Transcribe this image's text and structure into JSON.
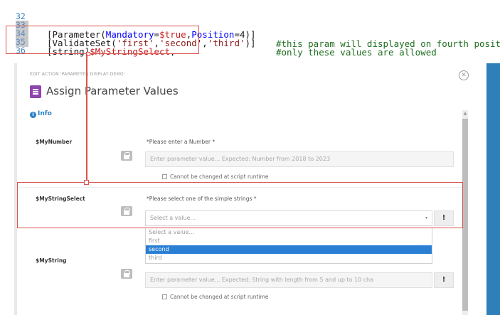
{
  "code": {
    "lines": [
      {
        "num": "32",
        "content": [],
        "comment": ""
      },
      {
        "num": "33",
        "content": [
          {
            "t": "[Parameter(",
            "c": ""
          },
          {
            "t": "Mandatory",
            "c": "k"
          },
          {
            "t": "=",
            "c": ""
          },
          {
            "t": "$true",
            "c": "v"
          },
          {
            "t": ",",
            "c": ""
          },
          {
            "t": "Position",
            "c": "k"
          },
          {
            "t": "=4)]",
            "c": ""
          }
        ],
        "comment": "#this param will displayed on fourth positi"
      },
      {
        "num": "34",
        "content": [
          {
            "t": "[ValidateSet(",
            "c": ""
          },
          {
            "t": "'first'",
            "c": "s"
          },
          {
            "t": ",",
            "c": ""
          },
          {
            "t": "'second'",
            "c": "s"
          },
          {
            "t": ",",
            "c": ""
          },
          {
            "t": "'third'",
            "c": "s"
          },
          {
            "t": ")]",
            "c": ""
          }
        ],
        "comment": "#only these values are allowed"
      },
      {
        "num": "35",
        "content": [
          {
            "t": "[string]",
            "c": ""
          },
          {
            "t": "$MyStringSelect",
            "c": "v"
          },
          {
            "t": ",",
            "c": ""
          }
        ],
        "comment": ""
      },
      {
        "num": "36",
        "content": [],
        "comment": ""
      }
    ]
  },
  "dialog": {
    "eyebrow": "EDIT ACTION 'PARAMETER DISPLAY DEMO'",
    "close_glyph": "✕",
    "title": "Assign Parameter Values",
    "info_label": "Info",
    "info_glyph": "i",
    "scroll_up_glyph": "▲",
    "params": [
      {
        "name": "$MyNumber",
        "description": "*Please enter a Number *",
        "placeholder": "Enter parameter value... Expected: Number from 2018 to 2023",
        "checkbox_label": "Cannot be changed at script runtime"
      },
      {
        "name": "$MyStringSelect",
        "description": "*Please select one of the simple strings *",
        "selected": "Select a value...",
        "caret_glyph": "▾",
        "action_label": "!",
        "options": [
          "Select a value...",
          "first",
          "second",
          "third"
        ],
        "highlighted_option": "second"
      },
      {
        "name": "$MyString",
        "placeholder": "Enter parameter value... Expected: String with length from 5 and up to 10 cha",
        "action_label": "!",
        "checkbox_label": "Cannot be changed at script runtime"
      }
    ]
  },
  "colors": {
    "annotation_red": "#d9534f",
    "accent_blue": "#2a7fd4",
    "title_icon_purple": "#8e44ad",
    "edge_blue": "#2f7fb8"
  }
}
